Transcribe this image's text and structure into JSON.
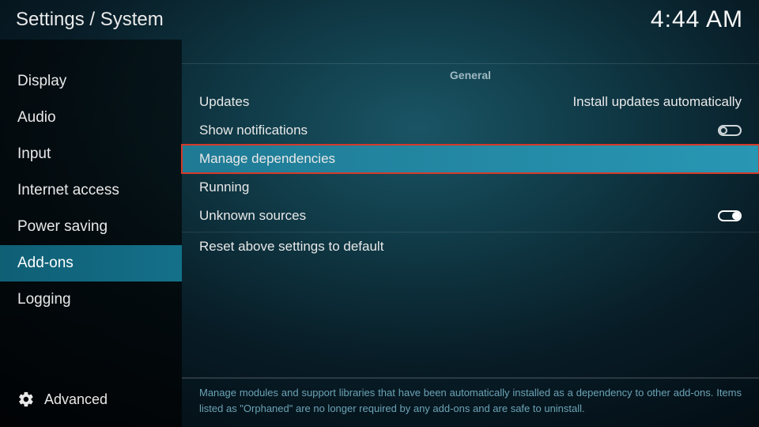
{
  "header": {
    "breadcrumb": "Settings / System",
    "clock": "4:44 AM"
  },
  "sidebar": {
    "items": [
      {
        "label": "Display"
      },
      {
        "label": "Audio"
      },
      {
        "label": "Input"
      },
      {
        "label": "Internet access"
      },
      {
        "label": "Power saving"
      },
      {
        "label": "Add-ons"
      },
      {
        "label": "Logging"
      }
    ],
    "level_label": "Advanced"
  },
  "section": {
    "title": "General",
    "rows": {
      "updates": {
        "label": "Updates",
        "value": "Install updates automatically"
      },
      "notifications": {
        "label": "Show notifications"
      },
      "manage": {
        "label": "Manage dependencies"
      },
      "running": {
        "label": "Running"
      },
      "unknown": {
        "label": "Unknown sources"
      },
      "reset": {
        "label": "Reset above settings to default"
      }
    }
  },
  "help": {
    "text": "Manage modules and support libraries that have been automatically installed as a dependency to other add-ons. Items listed as \"Orphaned\" are no longer required by any add-ons and are safe to uninstall."
  }
}
